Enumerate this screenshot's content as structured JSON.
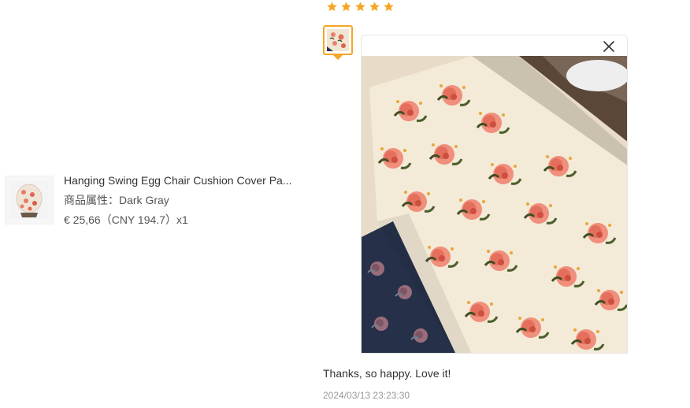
{
  "product": {
    "title": "Hanging Swing Egg Chair Cushion Cover Pa...",
    "attribute": "商品属性：Dark Gray",
    "price": "€ 25,66（CNY  194.7）x1",
    "thumbnail_icon": "floral-cushion-thumbnail"
  },
  "review": {
    "rating": 5,
    "star_color": "#f5a623",
    "thumbnail_icon": "review-photo-thumbnail",
    "close_icon": "close-icon",
    "text": "Thanks, so happy. Love it!",
    "date": "2024/03/13 23:23:30"
  }
}
